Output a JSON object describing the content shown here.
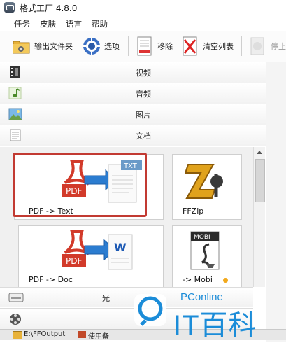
{
  "window": {
    "title": "格式工厂 4.8.0"
  },
  "menu": [
    "任务",
    "皮肤",
    "语言",
    "帮助"
  ],
  "toolbar": {
    "output_folder": "输出文件夹",
    "options": "选项",
    "remove": "移除",
    "clear_list": "清空列表",
    "stop": "停止"
  },
  "categories": [
    {
      "label": "视频",
      "icon": "film-icon"
    },
    {
      "label": "音频",
      "icon": "music-note-icon"
    },
    {
      "label": "图片",
      "icon": "picture-icon"
    },
    {
      "label": "文档",
      "icon": "document-icon"
    }
  ],
  "tiles": [
    {
      "label": "PDF -> Text",
      "icon": "pdf-to-text-icon",
      "selected": true
    },
    {
      "label": "FFZip",
      "icon": "ffzip-icon"
    },
    {
      "label": "PDF -> Doc",
      "icon": "pdf-to-doc-icon"
    },
    {
      "label": "-> Mobi",
      "icon": "mobi-icon"
    }
  ],
  "bottom": {
    "partial_label": "光"
  },
  "taskbar": {
    "item1": "E:\\FFOutput",
    "item2": "使用备"
  },
  "watermark": {
    "brand": "PConline",
    "name": "IT百科"
  },
  "colors": {
    "selection": "#c23a32",
    "pdf_red": "#d23a2a",
    "arrow_blue": "#2b7cd0",
    "watermark": "#1b8cd8"
  }
}
